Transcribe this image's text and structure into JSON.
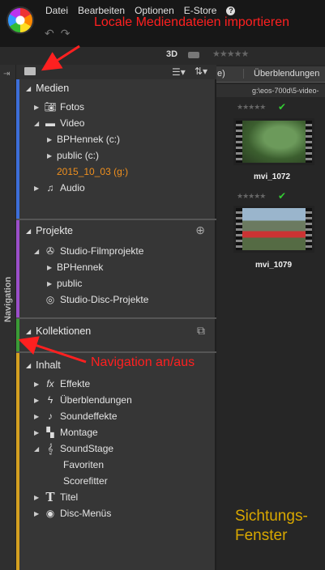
{
  "menu": {
    "items": [
      "Datei",
      "Bearbeiten",
      "Optionen",
      "E-Store"
    ],
    "help": "?"
  },
  "annotations": {
    "import": "Locale Mediendateien importieren",
    "nav_toggle": "Navigation an/aus",
    "viewer": "Sichtungs-\nFenster"
  },
  "toolbar": {
    "mode_3d": "3D",
    "stars": "★★★★★"
  },
  "strip": {
    "label": "Navigation",
    "pin": "⇥"
  },
  "sections": {
    "medien": {
      "title": "Medien",
      "color": "#3d6ed8",
      "items": [
        {
          "label": "Fotos",
          "icon": "camera-icon"
        },
        {
          "label": "Video",
          "icon": "video-icon"
        },
        {
          "label": "BPHennek (c:)"
        },
        {
          "label": "public (c:)"
        },
        {
          "label": "2015_10_03 (g:)"
        },
        {
          "label": "Audio",
          "icon": "music-note-icon"
        }
      ]
    },
    "projekte": {
      "title": "Projekte",
      "color": "#9b4fc9",
      "items": [
        {
          "label": "Studio-Filmprojekte",
          "icon": "film-reel-icon"
        },
        {
          "label": "BPHennek"
        },
        {
          "label": "public"
        },
        {
          "label": "Studio-Disc-Projekte",
          "icon": "disc-icon"
        }
      ]
    },
    "kollektionen": {
      "title": "Kollektionen",
      "color": "#3a9b35"
    },
    "inhalt": {
      "title": "Inhalt",
      "color": "#d4a020",
      "items": [
        {
          "label": "Effekte",
          "icon": "fx-icon"
        },
        {
          "label": "Überblendungen",
          "icon": "lightning-icon"
        },
        {
          "label": "Soundeffekte",
          "icon": "music-note-icon"
        },
        {
          "label": "Montage",
          "icon": "montage-icon"
        },
        {
          "label": "SoundStage",
          "icon": "treble-clef-icon"
        },
        {
          "label": "Favoriten"
        },
        {
          "label": "Scorefitter"
        },
        {
          "label": "Titel",
          "icon": "title-t-icon"
        },
        {
          "label": "Disc-Menüs",
          "icon": "disc-icon"
        }
      ]
    }
  },
  "content": {
    "tab_left": "e)",
    "tab_right": "Überblendungen",
    "path": "g:\\eos-700d\\5-video-",
    "clips": [
      {
        "name": "mvi_1072",
        "rating": "★★★★★"
      },
      {
        "name": "mvi_1079",
        "rating": "★★★★★"
      }
    ]
  },
  "colors": {
    "annotation": "#ff2020",
    "viewer_label": "#d9a800",
    "active_item": "#f0901e"
  }
}
